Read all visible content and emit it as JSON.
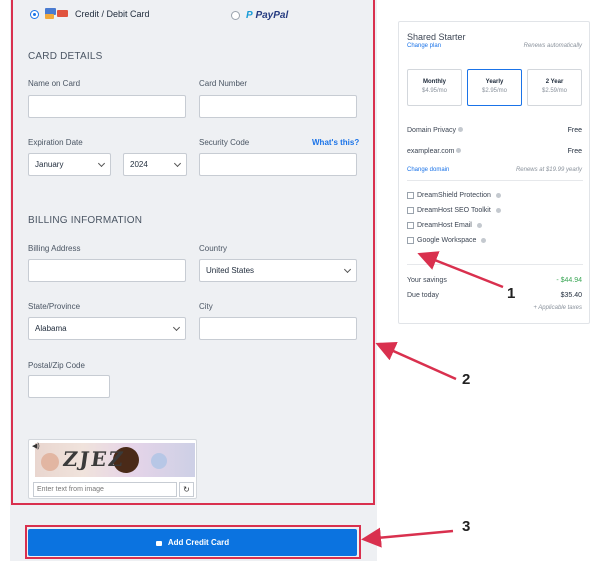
{
  "payment_methods": {
    "card_label": "Credit / Debit Card",
    "paypal_label": "PayPal",
    "selected": "card"
  },
  "card_details": {
    "title": "CARD DETAILS",
    "name_label": "Name on Card",
    "number_label": "Card Number",
    "expiration_label": "Expiration Date",
    "expiration_month": "January",
    "expiration_year": "2024",
    "security_label": "Security Code",
    "whats_this": "What's this?"
  },
  "billing": {
    "title": "BILLING INFORMATION",
    "address_label": "Billing Address",
    "country_label": "Country",
    "country_value": "United States",
    "state_label": "State/Province",
    "state_value": "Alabama",
    "city_label": "City",
    "zip_label": "Postal/Zip Code"
  },
  "captcha": {
    "image_text": "ZJEZ",
    "placeholder": "Enter text from image"
  },
  "add_card_button": "Add Credit Card",
  "summary": {
    "plan_name": "Shared Starter",
    "change_plan": "Change plan",
    "renews": "Renews automatically",
    "terms": [
      {
        "label": "Monthly",
        "price": "$4.95/mo",
        "selected": false
      },
      {
        "label": "Yearly",
        "price": "$2.95/mo",
        "selected": true
      },
      {
        "label": "2 Year",
        "price": "$2.59/mo",
        "selected": false
      }
    ],
    "domain_privacy_label": "Domain Privacy",
    "domain_privacy_value": "Free",
    "domain_label": "examplear.com",
    "domain_value": "Free",
    "change_domain": "Change domain",
    "domain_renews": "Renews at $19.99 yearly",
    "addons": [
      "DreamShield Protection",
      "DreamHost SEO Toolkit",
      "DreamHost Email",
      "Google Workspace"
    ],
    "savings_label": "Your savings",
    "savings_value": "- $44.94",
    "due_label": "Due today",
    "due_value": "$35.40",
    "taxes_note": "+ Applicable taxes"
  },
  "callouts": [
    "1",
    "2",
    "3"
  ],
  "colors": {
    "accent": "#1a73e8",
    "button": "#0b73e0",
    "annotation": "#d9304e",
    "savings": "#3aa655"
  }
}
